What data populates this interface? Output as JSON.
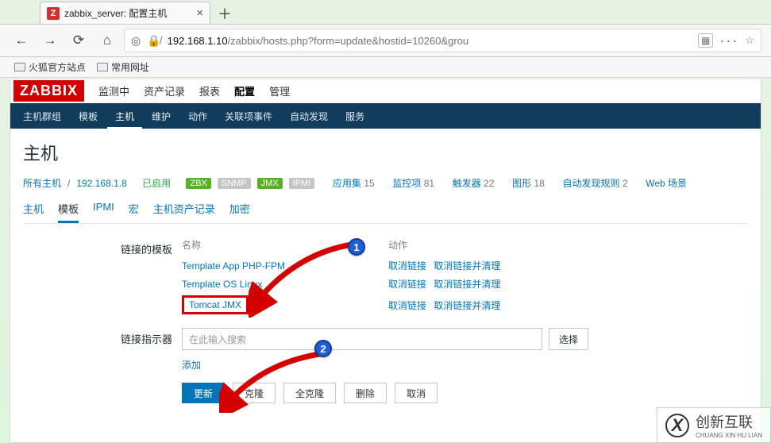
{
  "browser": {
    "tab_title": "zabbix_server: 配置主机",
    "url_display_dark": "192.168.1.10",
    "url_display_rest": "/zabbix/hosts.php?form=update&hostid=10260&grou",
    "bookmarks": [
      "火狐官方站点",
      "常用网址"
    ]
  },
  "zabbix": {
    "logo": "ZABBIX",
    "topnav": [
      "监测中",
      "资产记录",
      "报表",
      "配置",
      "管理"
    ],
    "topnav_active_index": 3,
    "subnav": [
      "主机群组",
      "模板",
      "主机",
      "维护",
      "动作",
      "关联项事件",
      "自动发现",
      "服务"
    ],
    "subnav_active_index": 2,
    "page_title": "主机",
    "breadcrumb": {
      "all_hosts": "所有主机",
      "host": "192.168.1.8",
      "status": "已启用",
      "pills": [
        "ZBX",
        "SNMP",
        "JMX",
        "IPMI"
      ]
    },
    "counters": [
      {
        "label": "应用集",
        "n": "15"
      },
      {
        "label": "监控项",
        "n": "81"
      },
      {
        "label": "触发器",
        "n": "22"
      },
      {
        "label": "图形",
        "n": "18"
      },
      {
        "label": "自动发现规则",
        "n": "2"
      },
      {
        "label": "Web 场景",
        "n": ""
      }
    ],
    "tabs2": [
      "主机",
      "模板",
      "IPMI",
      "宏",
      "主机资产记录",
      "加密"
    ],
    "tabs2_active_index": 1,
    "linked_label": "链接的模板",
    "tmpl_head_name": "名称",
    "tmpl_head_action": "动作",
    "templates": [
      {
        "name": "Template App PHP-FPM",
        "a1": "取消链接",
        "a2": "取消链接并清理"
      },
      {
        "name": "Template OS Linux",
        "a1": "取消链接",
        "a2": "取消链接并清理"
      },
      {
        "name": "Tomcat JMX",
        "a1": "取消链接",
        "a2": "取消链接并清理"
      }
    ],
    "link_indicator_label": "链接指示器",
    "search_placeholder": "在此输入搜索",
    "select_btn": "选择",
    "add_link": "添加",
    "buttons": {
      "update": "更新",
      "clone": "克隆",
      "full_clone": "全克隆",
      "delete": "删除",
      "cancel": "取消"
    }
  },
  "callouts": {
    "b1": "1",
    "b2": "2"
  },
  "watermark": {
    "brand": "创新互联",
    "sub": "CHUANG XIN HU LIAN"
  }
}
